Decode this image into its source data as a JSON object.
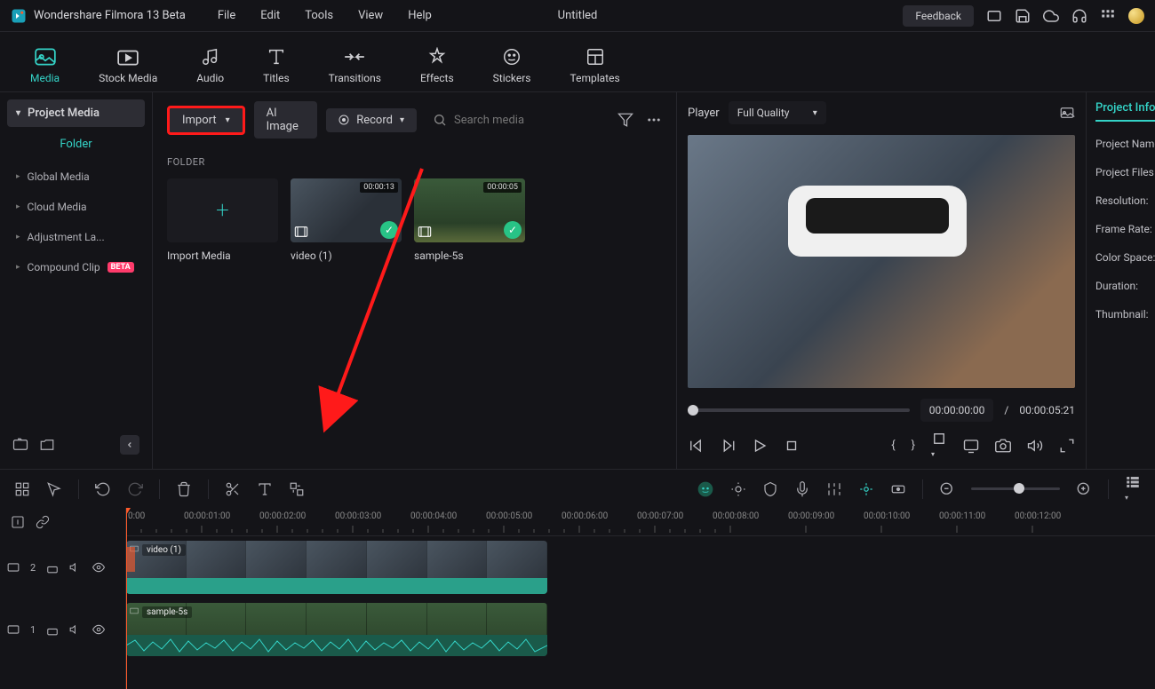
{
  "titlebar": {
    "app_name": "Wondershare Filmora 13 Beta",
    "menu": [
      "File",
      "Edit",
      "Tools",
      "View",
      "Help"
    ],
    "project_title": "Untitled",
    "feedback": "Feedback"
  },
  "tabs": {
    "items": [
      "Media",
      "Stock Media",
      "Audio",
      "Titles",
      "Transitions",
      "Effects",
      "Stickers",
      "Templates"
    ],
    "active": 0
  },
  "sidebar": {
    "project_media": "Project Media",
    "folder_label": "Folder",
    "items": [
      {
        "label": "Global Media"
      },
      {
        "label": "Cloud Media"
      },
      {
        "label": "Adjustment La..."
      },
      {
        "label": "Compound Clip",
        "beta": "BETA"
      }
    ]
  },
  "gallery": {
    "import": "Import",
    "ai_image": "AI Image",
    "record": "Record",
    "search_placeholder": "Search media",
    "folder_heading": "FOLDER",
    "items": [
      {
        "name": "Import Media",
        "importer": true
      },
      {
        "name": "video (1)",
        "duration": "00:00:13"
      },
      {
        "name": "sample-5s",
        "duration": "00:00:05"
      }
    ]
  },
  "player": {
    "label": "Player",
    "quality": "Full Quality",
    "time_current": "00:00:00:00",
    "time_sep": "/",
    "time_total": "00:00:05:21"
  },
  "info": {
    "tab": "Project Info",
    "rows": [
      "Project Name",
      "Project Files L",
      "Resolution:",
      "Frame Rate:",
      "Color Space:",
      "Duration:",
      "Thumbnail:"
    ]
  },
  "timeline": {
    "ruler": [
      "0:00",
      "00:00:01:00",
      "00:00:02:00",
      "00:00:03:00",
      "00:00:04:00",
      "00:00:05:00",
      "00:00:06:00",
      "00:00:07:00",
      "00:00:08:00",
      "00:00:09:00",
      "00:00:10:00",
      "00:00:11:00",
      "00:00:12:00"
    ],
    "tracks": [
      {
        "index": "2",
        "clip_label": "video (1)",
        "clip_start": 0,
        "clip_width": 474
      },
      {
        "index": "1",
        "clip_label": "sample-5s",
        "clip_start": 0,
        "clip_width": 474
      }
    ]
  }
}
